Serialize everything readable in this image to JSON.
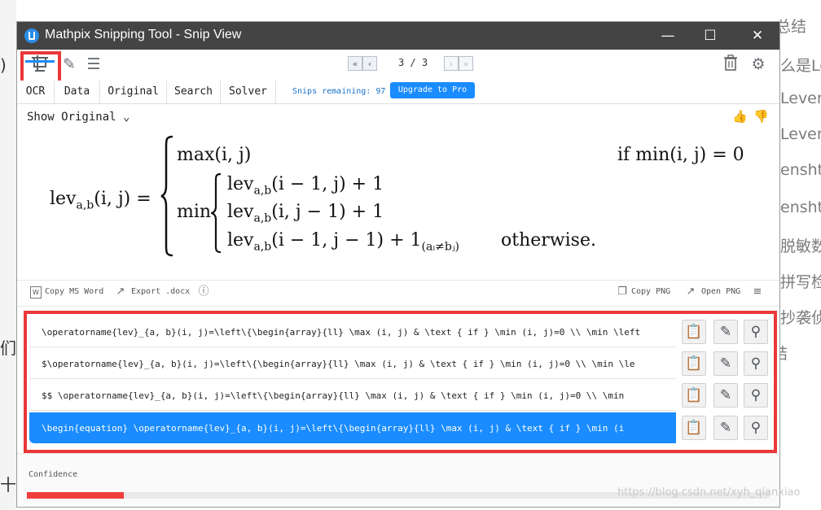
{
  "window": {
    "title": "Mathpix Snipping Tool - Snip View"
  },
  "pager": {
    "count": "3 / 3"
  },
  "tabs": [
    {
      "label": "OCR"
    },
    {
      "label": "Data"
    },
    {
      "label": "Original"
    },
    {
      "label": "Search"
    },
    {
      "label": "Solver"
    }
  ],
  "snips": {
    "remaining": "Snips remaining: 97",
    "upgrade_label": "Upgrade to Pro"
  },
  "render": {
    "show_original": "Show Original",
    "math": {
      "lhs_name": "lev",
      "lhs_sub": "a,b",
      "lhs_args": "(i, j) =",
      "max_line": "max(i, j)",
      "if_text": "if",
      "if_cond": "min(i, j) = 0",
      "min_text": "min",
      "line1": "lev",
      "line1_sub": "a,b",
      "line1_args": "(i − 1, j) + 1",
      "line2": "lev",
      "line2_sub": "a,b",
      "line2_args": "(i, j − 1) + 1",
      "line3": "lev",
      "line3_sub": "a,b",
      "line3_args": "(i − 1, j − 1) + 1",
      "line3_ind_sub": "(aᵢ≠bⱼ)",
      "otherwise": "otherwise."
    }
  },
  "actions": {
    "copy_word": "Copy MS Word",
    "export_docx": "Export .docx",
    "copy_png": "Copy PNG",
    "open_png": "Open PNG"
  },
  "results": [
    {
      "text": "\\operatorname{lev}_{a, b}(i, j)=\\left\\{\\begin{array}{ll} \\max (i, j) & \\text { if } \\min (i, j)=0 \\\\ \\min \\left",
      "selected": false
    },
    {
      "text": "$\\operatorname{lev}_{a, b}(i, j)=\\left\\{\\begin{array}{ll} \\max (i, j) & \\text { if } \\min (i, j)=0 \\\\ \\min \\le",
      "selected": false
    },
    {
      "text": "$$  \\operatorname{lev}_{a, b}(i, j)=\\left\\{\\begin{array}{ll} \\max (i, j) & \\text { if } \\min (i, j)=0 \\\\ \\min",
      "selected": false
    },
    {
      "text": "\\begin{equation}  \\operatorname{lev}_{a, b}(i, j)=\\left\\{\\begin{array}{ll} \\max (i, j) & \\text { if } \\min (i",
      "selected": true
    }
  ],
  "confidence": {
    "label": "Confidence",
    "value_fraction": 0.13
  },
  "background": {
    "right_lines": [
      "4. 总结",
      "么是Le",
      "Leven",
      "Leven",
      "ensht",
      "ensht",
      "脱敏数",
      "拼写检",
      "抄袭侦",
      "结"
    ],
    "left_glyphs": [
      ")",
      "们",
      "十"
    ],
    "watermark": "https://blog.csdn.net/xyh_qianxiao"
  },
  "colors": {
    "accent": "#1a8cff",
    "highlight": "#ea3838",
    "titlebar": "#444444"
  }
}
